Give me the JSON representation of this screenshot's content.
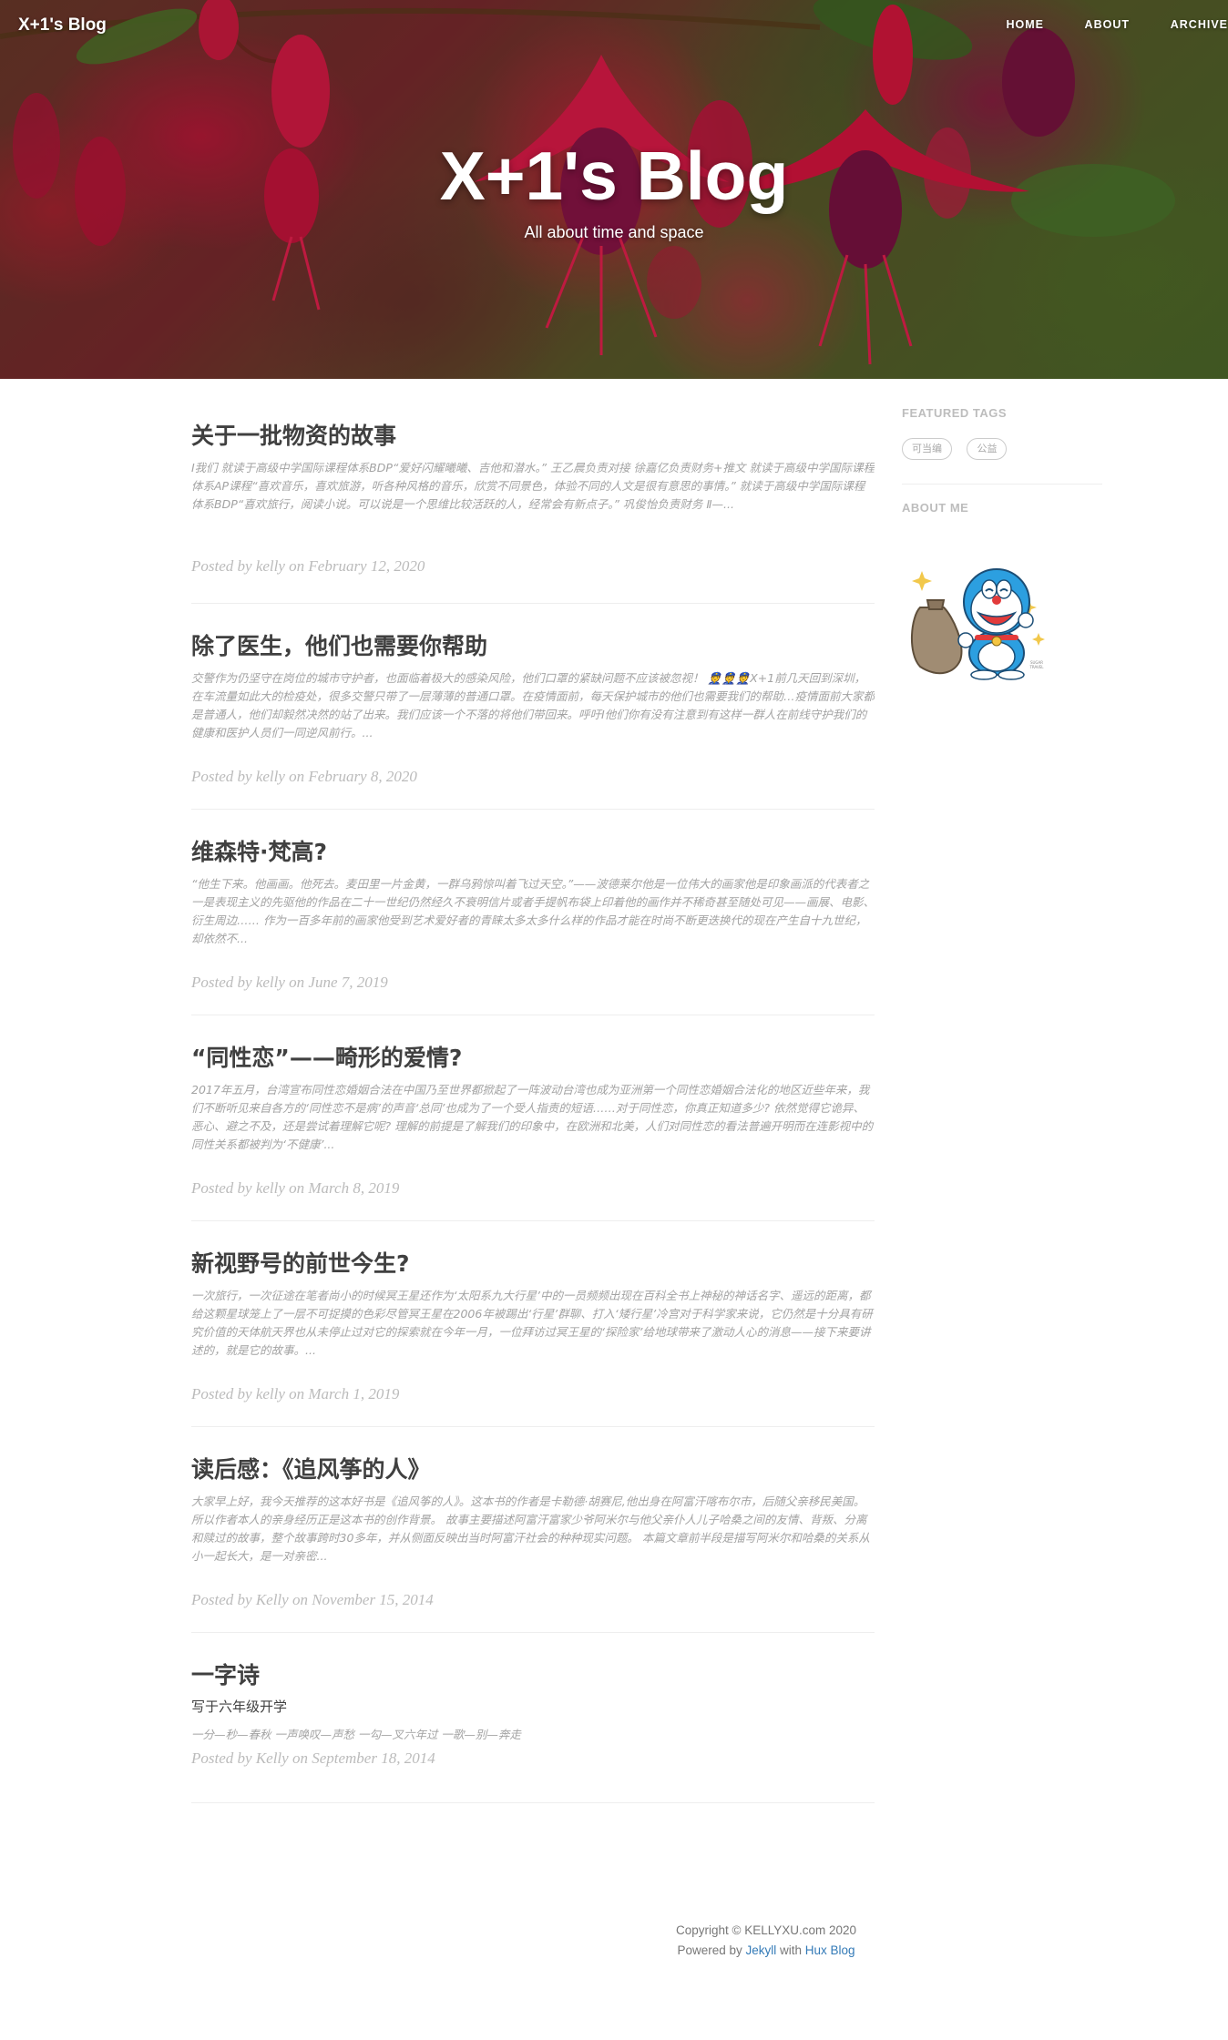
{
  "header": {
    "brand": "X+1's Blog",
    "nav": [
      {
        "label": "HOME"
      },
      {
        "label": "ABOUT"
      },
      {
        "label": "ARCHIVE"
      }
    ],
    "title": "X+1's Blog",
    "subtitle": "All about time and space"
  },
  "posts": [
    {
      "title": "关于一批物资的故事",
      "subtitle": "",
      "excerpt": "Ⅰ我们 就读于高级中学国际课程体系BDP“爱好闪耀曦曦、吉他和潜水。” 王乙晨负责对接 徐嘉亿负责财务+推文 就读于高级中学国际课程体系AP课程“喜欢音乐，喜欢旅游，听各种风格的音乐，欣赏不同景色，体验不同的人文是很有意思的事情。” 就读于高级中学国际课程体系BDP“喜欢旅行，阅读小说。可以说是一个思维比较活跃的人，经常会有新点子。” 巩俊怡负责财务 Ⅱ—...",
      "meta": "Posted by kelly on February 12, 2020"
    },
    {
      "title": "除了医生，他们也需要你帮助",
      "subtitle": "",
      "excerpt": "交警作为仍坚守在岗位的城市守护者，也面临着极大的感染风险，他们口罩的紧缺问题不应该被忽视！ 👮👮👮X+1前几天回到深圳，在车流量如此大的检疫处，很多交警只带了一层薄薄的普通口罩。在疫情面前，每天保护城市的他们也需要我们的帮助…疫情面前大家都是普通人，他们却毅然决然的站了出来。我们应该一个不落的将他们带回来。呼吁Ⅰ他们你有没有注意到有这样一群人在前线守护我们的健康和医护人员们一同逆风前行。...",
      "meta": "Posted by kelly on February 8, 2020"
    },
    {
      "title": "维森特·梵高?",
      "subtitle": "",
      "excerpt": "“他生下来。他画画。他死去。麦田里一片金黄，一群乌鸦惊叫着飞过天空。”——波德莱尔他是一位伟大的画家他是印象画派的代表者之一是表现主义的先驱他的作品在二十一世纪仍然经久不衰明信片或者手提帆布袋上印着他的画作并不稀奇甚至随处可见——画展、电影、衍生周边…… 作为一百多年前的画家他受到艺术爱好者的青睐太多太多什么样的作品才能在时尚不断更迭换代的现在产生自十九世纪，却依然不...",
      "meta": "Posted by kelly on June 7, 2019"
    },
    {
      "title": "“同性恋”——畸形的爱情?",
      "subtitle": "",
      "excerpt": "2017年五月，台湾宣布同性恋婚姻合法在中国乃至世界都掀起了一阵波动台湾也成为亚洲第一个同性恋婚姻合法化的地区近些年来，我们不断听见来自各方的‘同性恋不是病’的声音‘总同’也成为了一个受人指责的短语……对于同性恋，你真正知道多少? 依然觉得它诡异、恶心、避之不及，还是尝试着理解它呢? 理解的前提是了解我们的印象中，在欧洲和北美，人们对同性恋的看法普遍开明而在连影视中的同性关系都被判为‘不健康’...",
      "meta": "Posted by kelly on March 8, 2019"
    },
    {
      "title": "新视野号的前世今生?",
      "subtitle": "",
      "excerpt": "一次旅行，一次征途在笔者尚小的时候冥王星还作为‘太阳系九大行星’中的一员频频出现在百科全书上神秘的神话名字、遥远的距离，都给这颗星球笼上了一层不可捉摸的色彩尽管冥王星在2006年被踢出‘行星’群聊、打入‘矮行星’冷宫对于科学家来说，它仍然是十分具有研究价值的天体航天界也从未停止过对它的探索就在今年一月，一位拜访过冥王星的‘探险家’给地球带来了激动人心的消息——接下来要讲述的，就是它的故事。...",
      "meta": "Posted by kelly on March 1, 2019"
    },
    {
      "title": "读后感：《追风筝的人》",
      "subtitle": "",
      "excerpt": "大家早上好，我今天推荐的这本好书是《追风筝的人》。这本书的作者是卡勒德·胡赛尼,他出身在阿富汗喀布尔市，后随父亲移民美国。所以作者本人的亲身经历正是这本书的创作背景。 故事主要描述阿富汗富家少爷阿米尔与他父亲仆人儿子哈桑之间的友情、背叛、分离和赎过的故事，整个故事跨时30多年，并从侧面反映出当时阿富汗社会的种种现实问题。 本篇文章前半段是描写阿米尔和哈桑的关系从小一起长大，是一对亲密...",
      "meta": "Posted by Kelly on November 15, 2014"
    },
    {
      "title": "一字诗",
      "subtitle": "写于六年级开学",
      "excerpt": "一分—秒—春秋 一声唤叹—声愁 一勾—叉六年过 一歌—别—奔走",
      "meta": "Posted by Kelly on September 18, 2014"
    }
  ],
  "sidebar": {
    "featured_tags_heading": "FEATURED TAGS",
    "tags": [
      "可当编",
      "公益"
    ],
    "about_heading": "ABOUT ME",
    "avatar_badge": "SUGAR TRAVEL"
  },
  "footer": {
    "copyright": "Copyright © KELLYXU.com 2020",
    "powered_prefix": "Powered by ",
    "jekyll": "Jekyll",
    "with": " with ",
    "hux": "Hux Blog"
  },
  "colors": {
    "accent_link": "#337ab7",
    "text": "#404040",
    "muted": "#a3a3a3",
    "hero_red": "#d4153a"
  }
}
